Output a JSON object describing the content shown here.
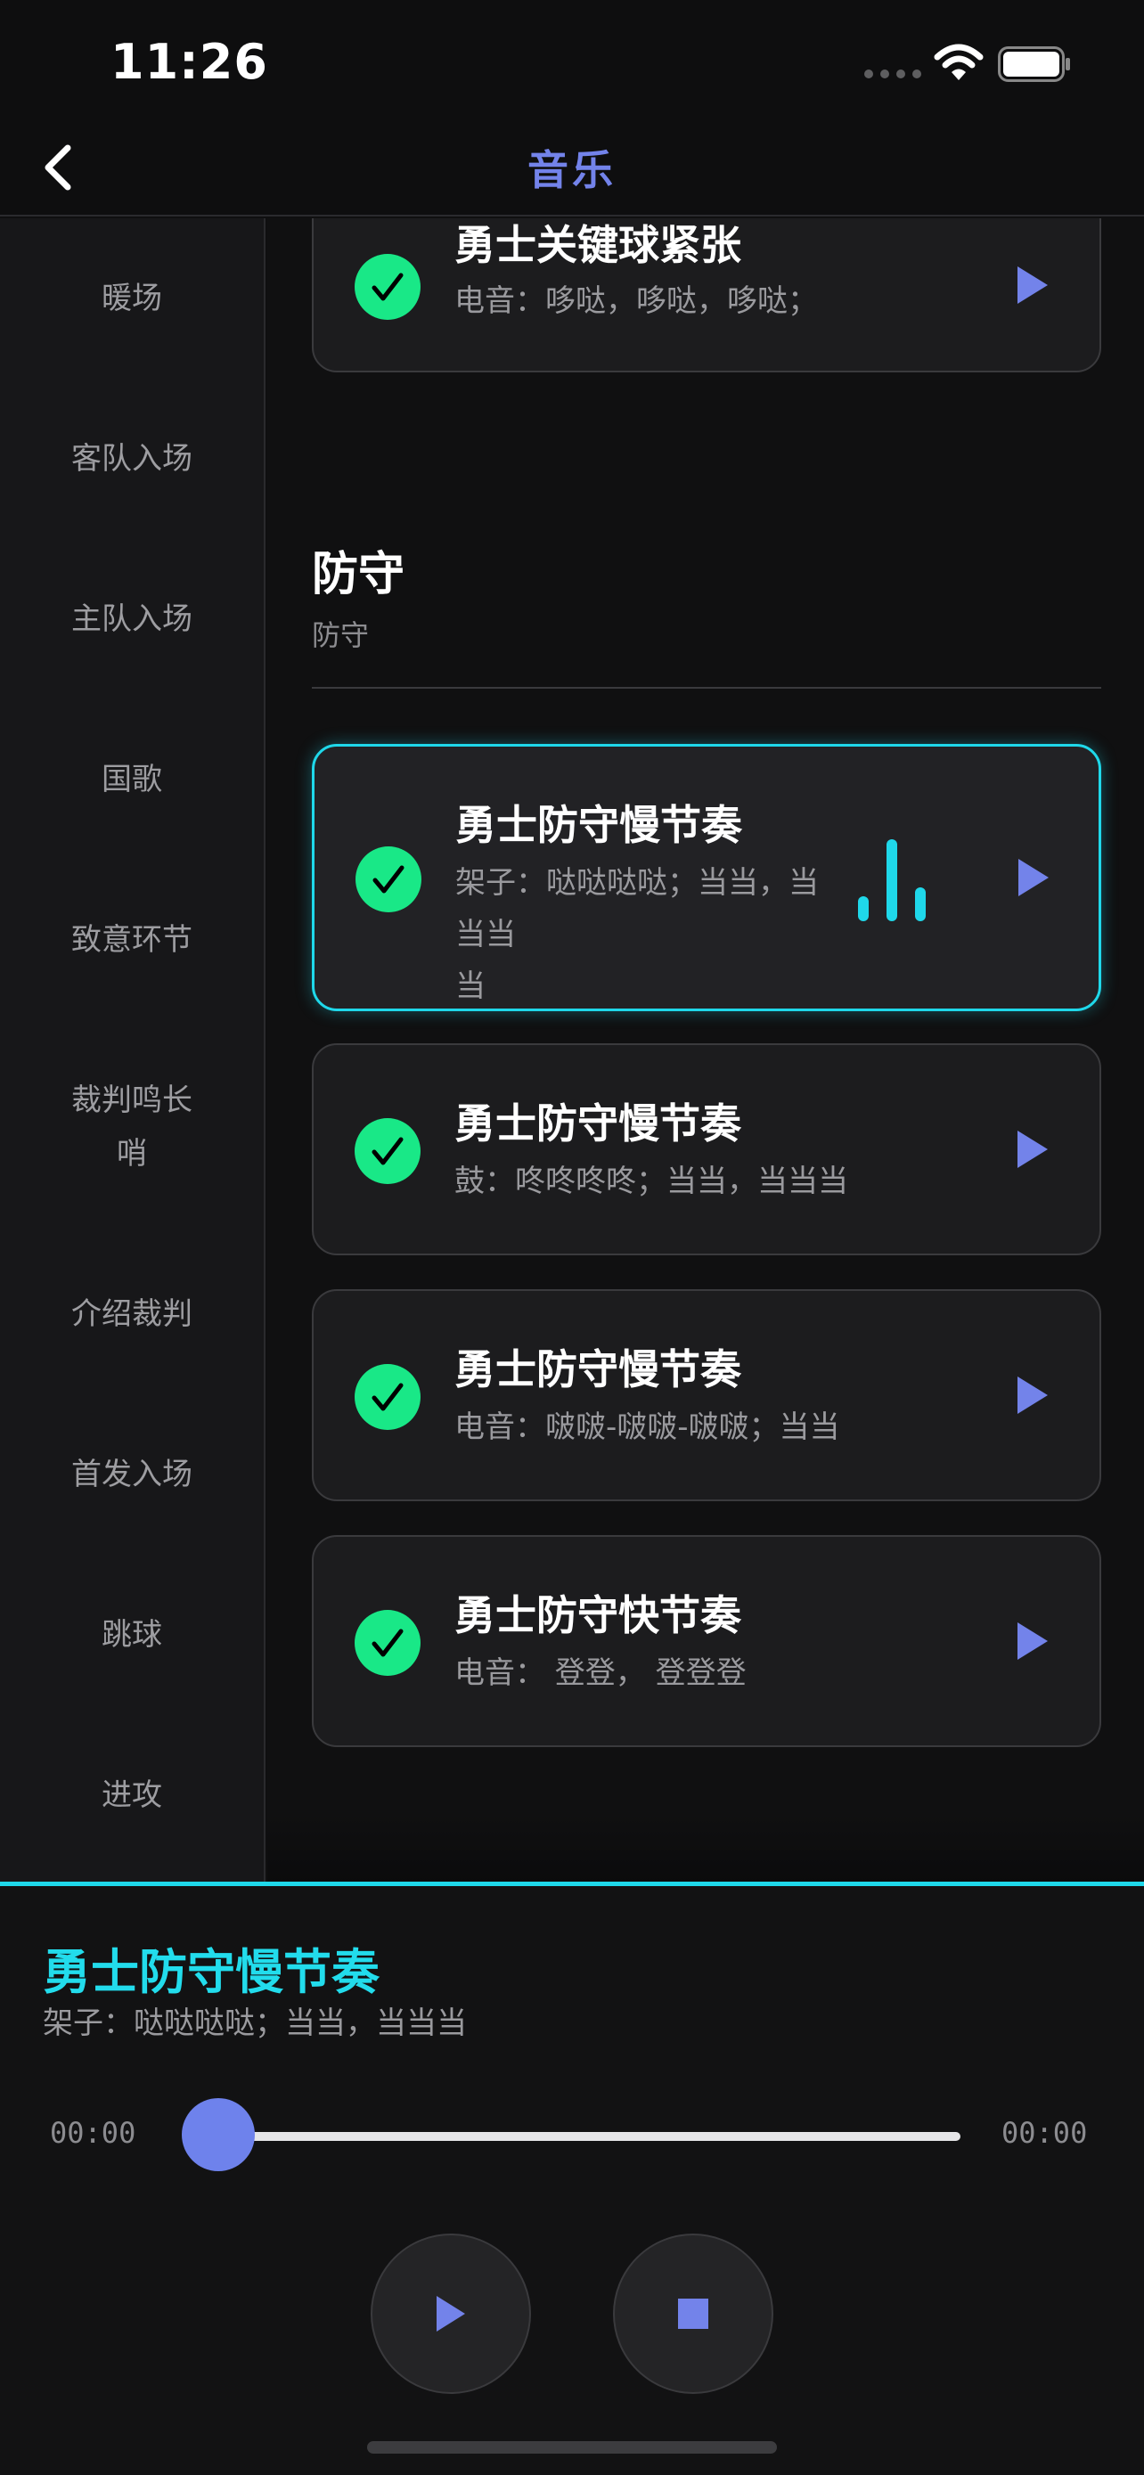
{
  "status_bar": {
    "time": "11:26"
  },
  "nav": {
    "title": "音乐"
  },
  "sidebar": {
    "items": [
      {
        "label": "暖场"
      },
      {
        "label": "客队入场"
      },
      {
        "label": "主队入场"
      },
      {
        "label": "国歌"
      },
      {
        "label": "致意环节"
      },
      {
        "label": "裁判鸣长\n哨"
      },
      {
        "label": "介绍裁判"
      },
      {
        "label": "首发入场"
      },
      {
        "label": "跳球"
      },
      {
        "label": "进攻"
      }
    ]
  },
  "content": {
    "prev_card": {
      "title": "勇士关键球紧张",
      "subtitle": "电音：哆哒，哆哒，哆哒；"
    },
    "section": {
      "title": "防守",
      "subtitle": "防守"
    },
    "cards": [
      {
        "title": "勇士防守慢节奏",
        "subtitle": "架子：哒哒哒哒；当当，当当当\n当",
        "active": true
      },
      {
        "title": "勇士防守慢节奏",
        "subtitle": "鼓：咚咚咚咚；当当，当当当",
        "active": false
      },
      {
        "title": "勇士防守慢节奏",
        "subtitle": "电音：啵啵-啵啵-啵啵；当当",
        "active": false
      },
      {
        "title": "勇士防守快节奏",
        "subtitle": "电音： 登登， 登登登",
        "active": false
      }
    ]
  },
  "player": {
    "title": "勇士防守慢节奏",
    "subtitle": "架子：哒哒哒哒；当当，当当当",
    "time_elapsed": "00:00",
    "time_total": "00:00",
    "progress": 0
  },
  "colors": {
    "accent": "#7383ea",
    "cyan": "#1fd8ea",
    "check_green": "#19e887",
    "thumb": "#6e82ec"
  },
  "icons": [
    "back-chevron-icon",
    "wifi-icon",
    "battery-icon",
    "check-icon",
    "play-icon",
    "equalizer-icon",
    "stop-icon"
  ]
}
